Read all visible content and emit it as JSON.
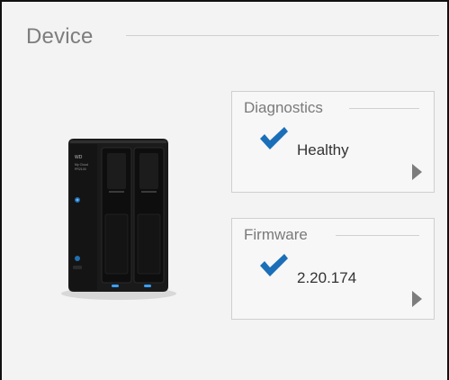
{
  "device_panel": {
    "title": "Device",
    "diagnostics": {
      "title": "Diagnostics",
      "status": "Healthy",
      "status_icon": "checkmark-icon"
    },
    "firmware": {
      "title": "Firmware",
      "version": "2.20.174",
      "status_icon": "checkmark-icon"
    },
    "device_image": {
      "brand_text": "WD",
      "model_text": "My Cloud",
      "submodel_text": "PR2100"
    }
  },
  "colors": {
    "check": "#1b6fb8",
    "title_text": "#7d7d7d",
    "arrow": "#7d7d7d"
  }
}
